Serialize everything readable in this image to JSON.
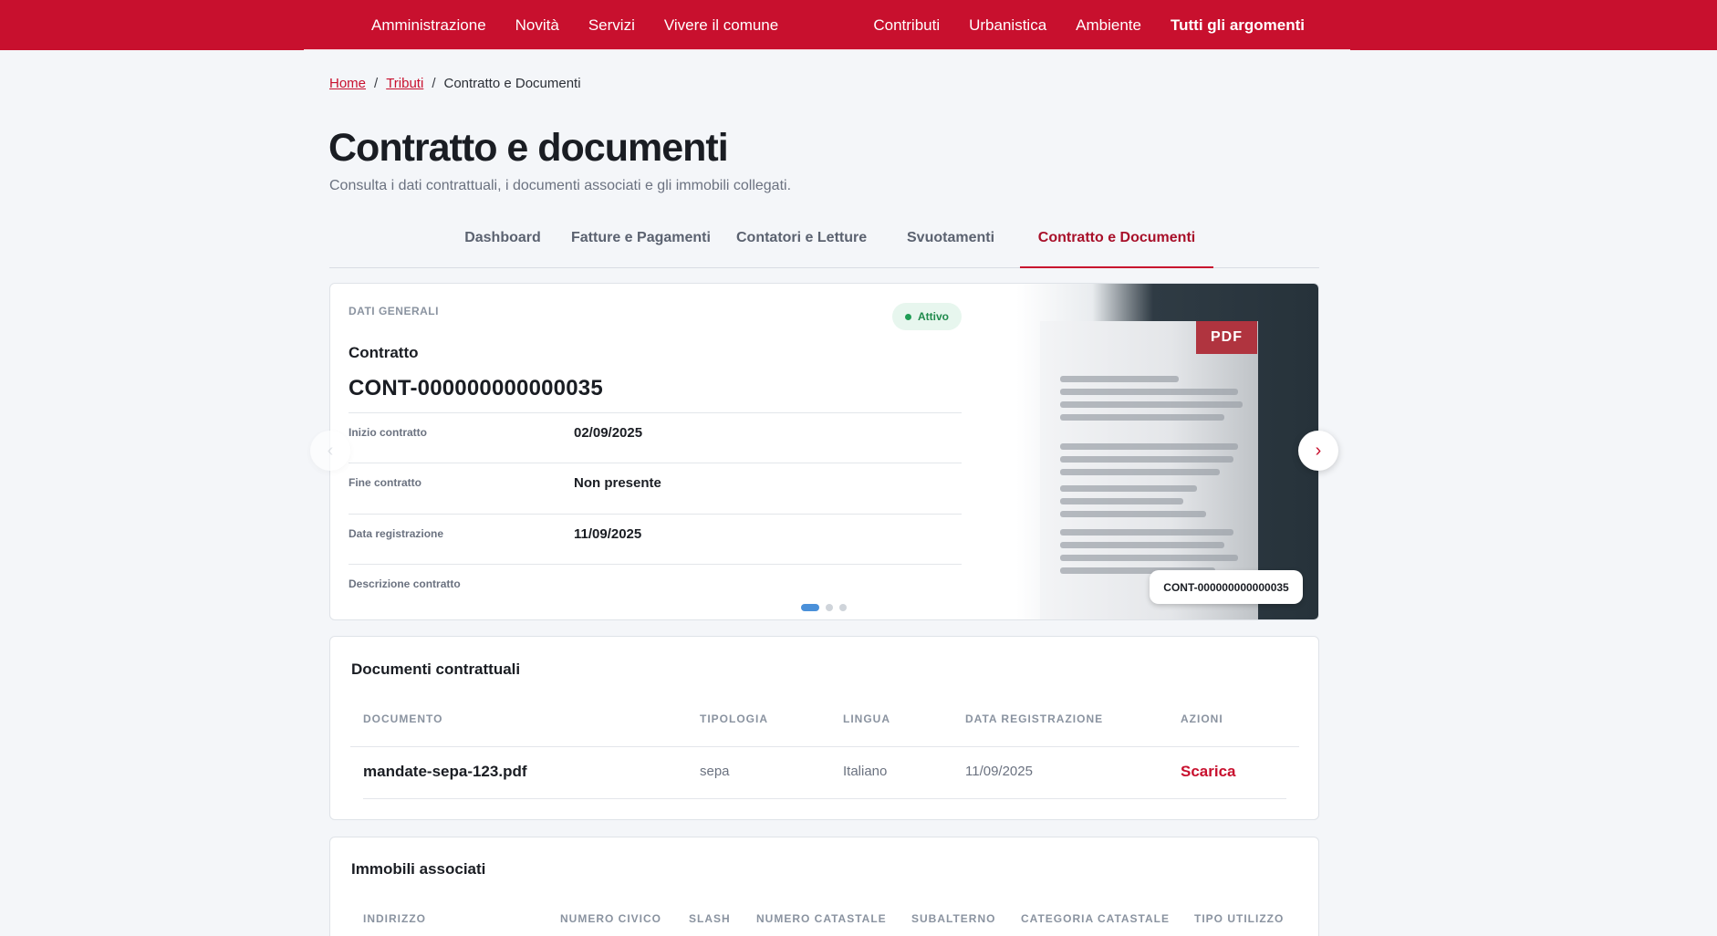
{
  "nav": {
    "left": [
      "Amministrazione",
      "Novità",
      "Servizi",
      "Vivere il comune"
    ],
    "right": [
      "Contributi",
      "Urbanistica",
      "Ambiente",
      "Tutti gli argomenti"
    ]
  },
  "breadcrumb": {
    "home": "Home",
    "tributi": "Tributi",
    "current": "Contratto e Documenti",
    "separator": "/"
  },
  "page": {
    "title": "Contratto e documenti",
    "subtitle": "Consulta i dati contrattuali, i documenti associati e gli immobili collegati."
  },
  "tabs": [
    {
      "label": "Dashboard"
    },
    {
      "label": "Fatture e Pagamenti"
    },
    {
      "label": "Contatori e Letture"
    },
    {
      "label": "Svuotamenti"
    },
    {
      "label": "Contratto e Documenti"
    }
  ],
  "contract": {
    "kicker": "DATI GENERALI",
    "status": "Attivo",
    "label": "Contratto",
    "id": "CONT-000000000000035",
    "fields": [
      {
        "key": "Inizio contratto",
        "value": "02/09/2025"
      },
      {
        "key": "Fine contratto",
        "value": "Non presente"
      },
      {
        "key": "Data registrazione",
        "value": "11/09/2025"
      },
      {
        "key": "Descrizione contratto",
        "value": ""
      }
    ],
    "carousel_pages": 3,
    "carousel_active": 1
  },
  "preview": {
    "badge": "PDF",
    "label": "CONT-000000000000035"
  },
  "icons": {
    "next": "chevron-right-icon",
    "prev": "chevron-left-icon"
  },
  "documents": {
    "title": "Documenti contrattuali",
    "columns": [
      "DOCUMENTO",
      "TIPOLOGIA",
      "LINGUA",
      "DATA REGISTRAZIONE",
      "AZIONI"
    ],
    "rows": [
      {
        "documento": "mandate-sepa-123.pdf",
        "tipologia": "sepa",
        "lingua": "Italiano",
        "data": "11/09/2025",
        "azione": "Scarica"
      }
    ]
  },
  "properties": {
    "title": "Immobili associati",
    "columns": [
      "INDIRIZZO",
      "NUMERO CIVICO",
      "SLASH",
      "NUMERO CATASTALE",
      "SUBALTERNO",
      "CATEGORIA CATASTALE",
      "TIPO UTILIZZO"
    ]
  },
  "colors": {
    "brand": "#c8102e",
    "status_bg": "#e7f6ee",
    "status_text": "#1f8a4c",
    "carousel_dot_active": "#4a90d9"
  }
}
